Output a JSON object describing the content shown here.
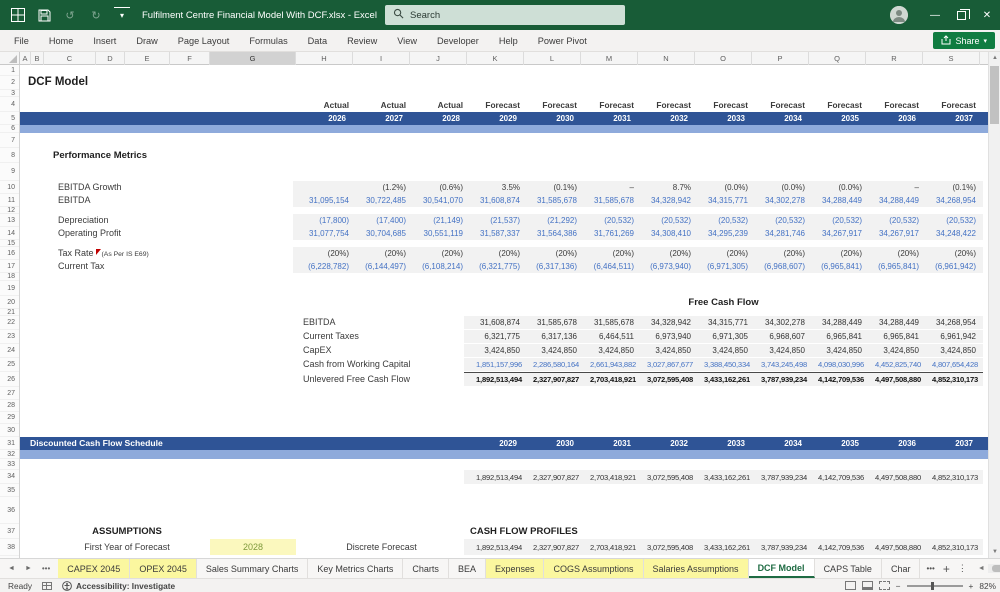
{
  "icons": {
    "undo": "↺",
    "redo": "↻",
    "chevron_down": "▾",
    "minimize": "—",
    "close": "✕",
    "up_arrow": "▲",
    "down_arrow": "▼",
    "left_arrow": "◄",
    "right_arrow": "►",
    "tab_left": "◄",
    "tab_right": "►",
    "ellipsis": "•••",
    "plus": "+",
    "kebab": "⋮",
    "minus": "−",
    "plus_small": "+"
  },
  "titlebar": {
    "title": "Fulfilment Centre Financial Model With DCF.xlsx  -  Excel",
    "search_placeholder": "Search"
  },
  "ribbon": {
    "tabs": [
      "File",
      "Home",
      "Insert",
      "Draw",
      "Page Layout",
      "Formulas",
      "Data",
      "Review",
      "View",
      "Developer",
      "Help",
      "Power Pivot"
    ],
    "share_label": "Share"
  },
  "grid": {
    "col_letters": [
      "A",
      "B",
      "C",
      "D",
      "E",
      "F",
      "G",
      "H",
      "I",
      "J",
      "K",
      "L",
      "M",
      "N",
      "O",
      "P",
      "Q",
      "R",
      "S"
    ],
    "selected_column": "G",
    "row_numbers": [
      "1",
      "2",
      "3",
      "4",
      "5",
      "6",
      "7",
      "8",
      "9",
      "10",
      "11",
      "12",
      "13",
      "14",
      "15",
      "16",
      "17",
      "18",
      "19",
      "20",
      "21",
      "22",
      "23",
      "24",
      "25",
      "26",
      "27",
      "28",
      "29",
      "30",
      "31",
      "32",
      "33",
      "34",
      "35",
      "36",
      "37",
      "38"
    ]
  },
  "sheet": {
    "title": "DCF Model",
    "header": {
      "types": [
        "Actual",
        "Actual",
        "Actual",
        "Forecast",
        "Forecast",
        "Forecast",
        "Forecast",
        "Forecast",
        "Forecast",
        "Forecast",
        "Forecast",
        "Forecast"
      ],
      "years": [
        "2026",
        "2027",
        "2028",
        "2029",
        "2030",
        "2031",
        "2032",
        "2033",
        "2034",
        "2035",
        "2036",
        "2037"
      ]
    },
    "performance": {
      "heading": "Performance Metrics",
      "rows": [
        {
          "label": "EBITDA Growth",
          "values": [
            "",
            "(1.2%)",
            "(0.6%)",
            "3.5%",
            "(0.1%)",
            "–",
            "8.7%",
            "(0.0%)",
            "(0.0%)",
            "(0.0%)",
            "–",
            "(0.1%)"
          ]
        },
        {
          "label": "EBITDA",
          "values": [
            "31,095,154",
            "30,722,485",
            "30,541,070",
            "31,608,874",
            "31,585,678",
            "31,585,678",
            "34,328,942",
            "34,315,771",
            "34,302,278",
            "34,288,449",
            "34,288,449",
            "34,268,954"
          ]
        },
        {
          "label": "Depreciation",
          "values": [
            "(17,800)",
            "(17,400)",
            "(21,149)",
            "(21,537)",
            "(21,292)",
            "(20,532)",
            "(20,532)",
            "(20,532)",
            "(20,532)",
            "(20,532)",
            "(20,532)",
            "(20,532)"
          ]
        },
        {
          "label": "Operating Profit",
          "values": [
            "31,077,754",
            "30,704,685",
            "30,551,119",
            "31,587,337",
            "31,564,386",
            "31,761,269",
            "34,308,410",
            "34,295,239",
            "34,281,746",
            "34,267,917",
            "34,267,917",
            "34,248,422"
          ]
        },
        {
          "label": "Tax Rate",
          "note": "(As Per IS E69)",
          "values": [
            "(20%)",
            "(20%)",
            "(20%)",
            "(20%)",
            "(20%)",
            "(20%)",
            "(20%)",
            "(20%)",
            "(20%)",
            "(20%)",
            "(20%)",
            "(20%)"
          ]
        },
        {
          "label": "Current Tax",
          "values": [
            "(6,228,782)",
            "(6,144,497)",
            "(6,108,214)",
            "(6,321,775)",
            "(6,317,136)",
            "(6,464,511)",
            "(6,973,940)",
            "(6,971,305)",
            "(6,968,607)",
            "(6,965,841)",
            "(6,965,841)",
            "(6,961,942)"
          ]
        }
      ]
    },
    "fcf": {
      "heading": "Free Cash Flow",
      "rows": [
        {
          "label": "EBITDA",
          "values": [
            "31,608,874",
            "31,585,678",
            "31,585,678",
            "34,328,942",
            "34,315,771",
            "34,302,278",
            "34,288,449",
            "34,288,449",
            "34,268,954"
          ]
        },
        {
          "label": "Current Taxes",
          "values": [
            "6,321,775",
            "6,317,136",
            "6,464,511",
            "6,973,940",
            "6,971,305",
            "6,968,607",
            "6,965,841",
            "6,965,841",
            "6,961,942"
          ]
        },
        {
          "label": "CapEX",
          "values": [
            "3,424,850",
            "3,424,850",
            "3,424,850",
            "3,424,850",
            "3,424,850",
            "3,424,850",
            "3,424,850",
            "3,424,850",
            "3,424,850"
          ]
        },
        {
          "label": "Cash from Working Capital",
          "values": [
            "1,851,157,996",
            "2,286,580,164",
            "2,661,943,882",
            "3,027,867,677",
            "3,388,450,334",
            "3,743,245,498",
            "4,098,030,996",
            "4,452,825,740",
            "4,807,654,428"
          ]
        },
        {
          "label": "Unlevered Free Cash Flow",
          "values": [
            "1,892,513,494",
            "2,327,907,827",
            "2,703,418,921",
            "3,072,595,408",
            "3,433,162,261",
            "3,787,939,234",
            "4,142,709,536",
            "4,497,508,880",
            "4,852,310,173"
          ]
        }
      ]
    },
    "dcf_schedule": {
      "heading": "Discounted Cash Flow Schedule",
      "years": [
        "2029",
        "2030",
        "2031",
        "2032",
        "2033",
        "2034",
        "2035",
        "2036",
        "2037"
      ],
      "values": [
        "1,892,513,494",
        "2,327,907,827",
        "2,703,418,921",
        "3,072,595,408",
        "3,433,162,261",
        "3,787,939,234",
        "4,142,709,536",
        "4,497,508,880",
        "4,852,310,173"
      ]
    },
    "assumptions": {
      "heading": "ASSUMPTIONS",
      "first_year_label": "First Year of Forecast",
      "first_year_value": "2028",
      "discrete_label": "Discrete Forecast"
    },
    "cash_flow_profiles": {
      "heading": "CASH FLOW PROFILES",
      "values": [
        "1,892,513,494",
        "2,327,907,827",
        "2,703,418,921",
        "3,072,595,408",
        "3,433,162,261",
        "3,787,939,234",
        "4,142,709,536",
        "4,497,508,880",
        "4,852,310,173"
      ]
    }
  },
  "sheet_tabs": [
    {
      "label": "CAPEX 2045"
    },
    {
      "label": "OPEX 2045"
    },
    {
      "label": "Sales Summary Charts"
    },
    {
      "label": "Key Metrics Charts"
    },
    {
      "label": "Charts"
    },
    {
      "label": "BEA"
    },
    {
      "label": "Expenses"
    },
    {
      "label": "COGS Assumptions"
    },
    {
      "label": "Salaries Assumptions"
    },
    {
      "label": "DCF Model"
    },
    {
      "label": "CAPS Table"
    },
    {
      "label": "Char"
    }
  ],
  "statusbar": {
    "ready_label": "Ready",
    "accessibility_label": "Accessibility: Investigate",
    "zoom_level": "82%"
  }
}
